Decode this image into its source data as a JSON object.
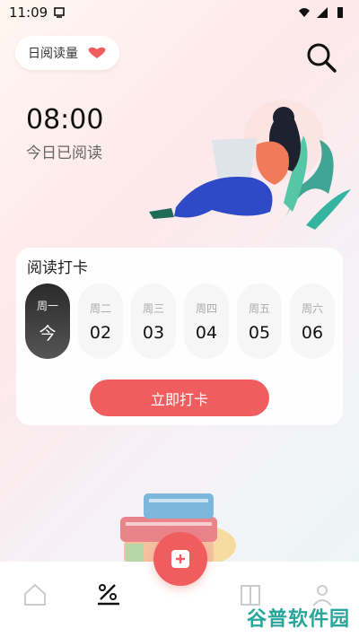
{
  "status_bar": {
    "time": "11:09"
  },
  "header": {
    "reading_pill_label": "日阅读量"
  },
  "today": {
    "time": "08:00",
    "subtitle": "今日已阅读"
  },
  "checkin_card": {
    "title": "阅读打卡",
    "days": [
      {
        "weekday": "周一",
        "value": "今",
        "active": true
      },
      {
        "weekday": "周二",
        "value": "02",
        "active": false
      },
      {
        "weekday": "周三",
        "value": "03",
        "active": false
      },
      {
        "weekday": "周四",
        "value": "04",
        "active": false
      },
      {
        "weekday": "周五",
        "value": "05",
        "active": false
      },
      {
        "weekday": "周六",
        "value": "06",
        "active": false
      }
    ],
    "button_label": "立即打卡"
  },
  "watermark": "谷普软件园",
  "colors": {
    "accent": "#f05d5f",
    "active_day": "#333333",
    "watermark": "#29a69a"
  },
  "icons": [
    "heart-icon",
    "search-icon",
    "home-icon",
    "percent-icon",
    "book-add-icon",
    "book-icon",
    "user-icon"
  ]
}
